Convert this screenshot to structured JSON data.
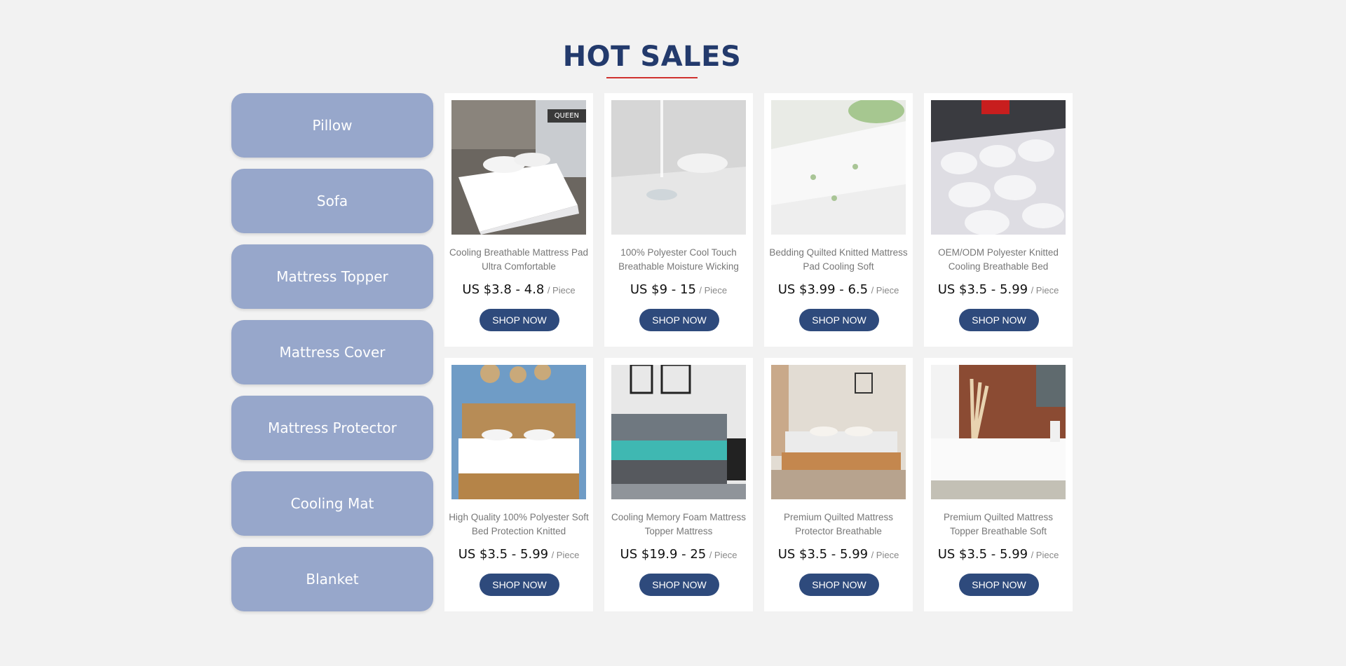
{
  "header": {
    "title": "HOT SALES"
  },
  "categories": [
    {
      "label": "Pillow"
    },
    {
      "label": "Sofa"
    },
    {
      "label": "Mattress Topper"
    },
    {
      "label": "Mattress Cover"
    },
    {
      "label": "Mattress Protector"
    },
    {
      "label": "Cooling Mat"
    },
    {
      "label": "Blanket"
    }
  ],
  "products": [
    {
      "name": "Cooling Breathable Mattress Pad Ultra Comfortable",
      "price": "US $3.8 - 4.8",
      "unit": "/ Piece",
      "button": "SHOP NOW",
      "badge": "QUEEN"
    },
    {
      "name": "100% Polyester Cool Touch Breathable Moisture Wicking",
      "price": "US $9 - 15",
      "unit": "/ Piece",
      "button": "SHOP NOW"
    },
    {
      "name": "Bedding Quilted Knitted Mattress Pad Cooling Soft",
      "price": "US $3.99 - 6.5",
      "unit": "/ Piece",
      "button": "SHOP NOW"
    },
    {
      "name": "OEM/ODM Polyester Knitted Cooling Breathable Bed",
      "price": "US $3.5 - 5.99",
      "unit": "/ Piece",
      "button": "SHOP NOW"
    },
    {
      "name": "High Quality 100% Polyester Soft Bed Protection Knitted",
      "price": "US $3.5 - 5.99",
      "unit": "/ Piece",
      "button": "SHOP NOW"
    },
    {
      "name": "Cooling Memory Foam Mattress Topper Mattress",
      "price": "US $19.9 - 25",
      "unit": "/ Piece",
      "button": "SHOP NOW"
    },
    {
      "name": "Premium Quilted Mattress Protector Breathable",
      "price": "US $3.5 - 5.99",
      "unit": "/ Piece",
      "button": "SHOP NOW"
    },
    {
      "name": "Premium Quilted Mattress Topper Breathable Soft",
      "price": "US $3.5 - 5.99",
      "unit": "/ Piece",
      "button": "SHOP NOW"
    }
  ],
  "colors": {
    "title": "#233a6c",
    "underline": "#d0322f",
    "category_bg": "#97a7cb",
    "button_bg": "#2e4a7c"
  }
}
